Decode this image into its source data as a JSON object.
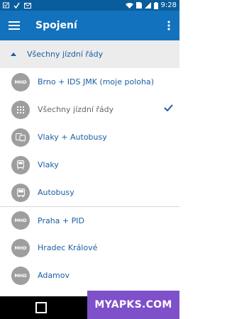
{
  "status_bar": {
    "time": "9:28"
  },
  "app_bar": {
    "title": "Spojení"
  },
  "section": {
    "label": "Všechny jízdní řády"
  },
  "items": [
    {
      "badge": "MHD",
      "label": "Brno + IDS JMK (moje poloha)",
      "icon": "mhd-badge-icon"
    },
    {
      "badge": "",
      "label": "Všechny jízdní řády",
      "icon": "grid-icon",
      "selected": true
    },
    {
      "badge": "",
      "label": "Vlaky + Autobusy",
      "icon": "train-bus-icon"
    },
    {
      "badge": "",
      "label": "Vlaky",
      "icon": "train-icon"
    },
    {
      "badge": "",
      "label": "Autobusy",
      "icon": "bus-icon"
    },
    {
      "badge": "MHD",
      "label": "Praha + PID",
      "icon": "mhd-badge-icon"
    },
    {
      "badge": "MHD",
      "label": "Hradec Králové",
      "icon": "mhd-badge-icon"
    },
    {
      "badge": "MHD",
      "label": "Adamov",
      "icon": "mhd-badge-icon"
    }
  ],
  "watermark": "MYAPKS.COM",
  "colors": {
    "primary": "#1272bd",
    "status": "#0a5d9c",
    "accent_text": "#1a5fa3",
    "check": "#1a5fa3"
  }
}
